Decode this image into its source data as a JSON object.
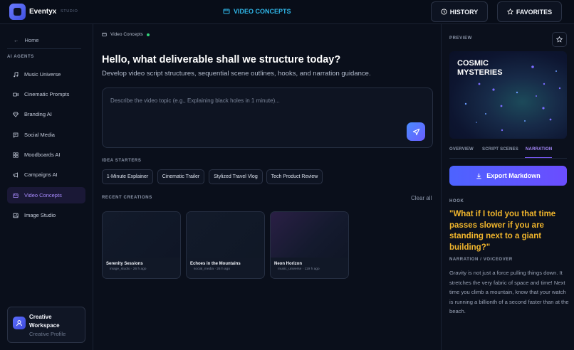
{
  "app": {
    "name": "Eventyx",
    "subtitle": "STUDIO"
  },
  "header": {
    "title": "VIDEO CONCEPTS",
    "history_label": "HISTORY",
    "favorites_label": "FAVORITES"
  },
  "sidebar": {
    "home_label": "Home",
    "section_title": "AI AGENTS",
    "items": [
      {
        "label": "Music Universe",
        "icon": "music-icon",
        "active": false
      },
      {
        "label": "Cinematic Prompts",
        "icon": "video-icon",
        "active": false
      },
      {
        "label": "Branding AI",
        "icon": "diamond-icon",
        "active": false
      },
      {
        "label": "Social Media",
        "icon": "chat-icon",
        "active": false
      },
      {
        "label": "Moodboards AI",
        "icon": "grid-icon",
        "active": false
      },
      {
        "label": "Campaigns AI",
        "icon": "megaphone-icon",
        "active": false
      },
      {
        "label": "Video Concepts",
        "icon": "film-icon",
        "active": true
      },
      {
        "label": "Image Studio",
        "icon": "image-icon",
        "active": false
      }
    ],
    "profile": {
      "name": "Creative Workspace",
      "subtitle": "Creative Profile"
    }
  },
  "main": {
    "breadcrumb": "Video Concepts",
    "heading": "Hello, what deliverable shall we structure today?",
    "subheading": "Develop video script structures, sequential scene outlines, hooks, and narration guidance.",
    "prompt_placeholder": "Describe the video topic (e.g., Explaining black holes in 1 minute)...",
    "idea_starters_label": "IDEA STARTERS",
    "idea_starters": [
      "1-Minute Explainer",
      "Cinematic Trailer",
      "Stylized Travel Vlog",
      "Tech Product Review"
    ],
    "recent_label": "RECENT CREATIONS",
    "clear_all_label": "Clear all",
    "recent": [
      {
        "title": "Serenity Sessions",
        "meta": "image_studio · 26 h ago"
      },
      {
        "title": "Echoes in the Mountains",
        "meta": "social_media · 26 h ago"
      },
      {
        "title": "Neon Horizon",
        "meta": "music_universe · 119 h ago"
      }
    ]
  },
  "panel": {
    "preview_label": "PREVIEW",
    "preview_title": "COSMIC MYSTERIES",
    "tabs": [
      "OVERVIEW",
      "SCRIPT SCENES",
      "NARRATION"
    ],
    "active_tab": "NARRATION",
    "export_label": "Export Markdown",
    "hook_label": "HOOK",
    "hook_text": "\"What if I told you that time passes slower if you are standing next to a giant building?\"",
    "voiceover_label": "NARRATION / VOICEOVER",
    "voiceover_text": "Gravity is not just a force pulling things down. It stretches the very fabric of space and time! Next time you climb a mountain, know that your watch is running a billionth of a second faster than at the beach."
  },
  "colors": {
    "accent": "#2fb6e8",
    "purple": "#a98bff",
    "hook": "#f0b52c",
    "online": "#33d17a"
  }
}
